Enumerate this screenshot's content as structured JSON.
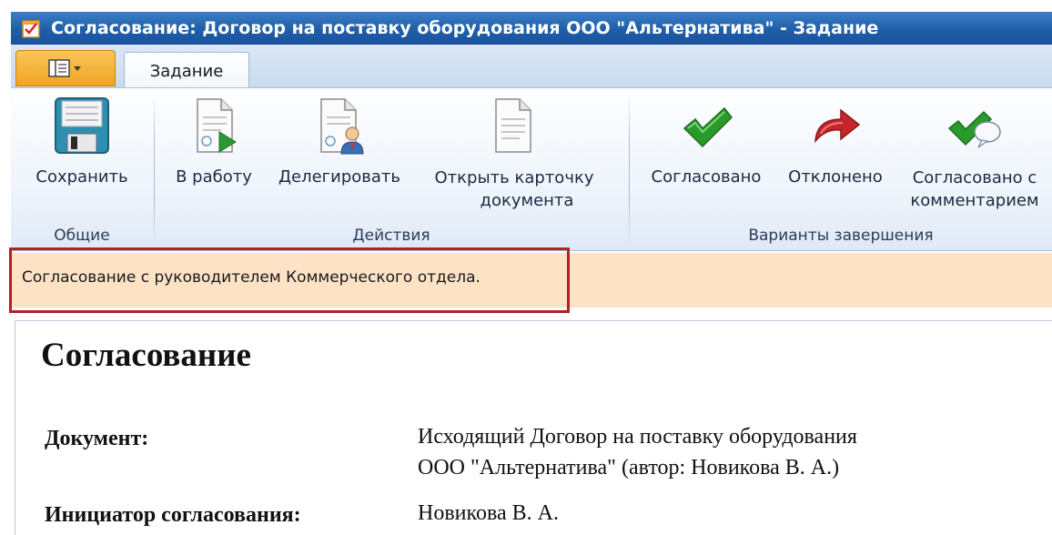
{
  "window": {
    "title": "Согласование: Договор на поставку оборудования ООО \"Альтернатива\" - Задание",
    "icon": "task-checkbox-icon"
  },
  "tabs": {
    "app_menu_icon": "app-menu-icon",
    "active": "Задание"
  },
  "ribbon": {
    "groups": [
      {
        "label": "Общие",
        "buttons": [
          {
            "label": "Сохранить",
            "icon": "save-icon"
          }
        ]
      },
      {
        "label": "Действия",
        "buttons": [
          {
            "label": "В работу",
            "icon": "document-play-icon"
          },
          {
            "label": "Делегировать",
            "icon": "document-user-icon"
          },
          {
            "label_line1": "Открыть карточку",
            "label_line2": "документа",
            "icon": "document-icon"
          }
        ]
      },
      {
        "label": "Варианты завершения",
        "buttons": [
          {
            "label": "Согласовано",
            "icon": "checkmark-icon"
          },
          {
            "label": "Отклонено",
            "icon": "reject-arrow-icon"
          },
          {
            "label_line1": "Согласовано с",
            "label_line2": "комментарием",
            "icon": "checkmark-comment-icon"
          }
        ]
      }
    ]
  },
  "infobar": {
    "text": "Согласование с руководителем Коммерческого отдела."
  },
  "document": {
    "heading": "Согласование",
    "fields": [
      {
        "label": "Документ:",
        "value_line1": "Исходящий Договор на поставку оборудования",
        "value_line2": "ООО \"Альтернатива\" (автор: Новикова В. А.)"
      },
      {
        "label": "Инициатор согласования:",
        "value_line1": "Новикова В. А."
      }
    ]
  },
  "colors": {
    "titlebar": "#1f5fa8",
    "infobar_bg": "#fde2c6",
    "highlight": "#b42025",
    "approve_green": "#2a9a2a",
    "reject_red": "#c4262b"
  }
}
